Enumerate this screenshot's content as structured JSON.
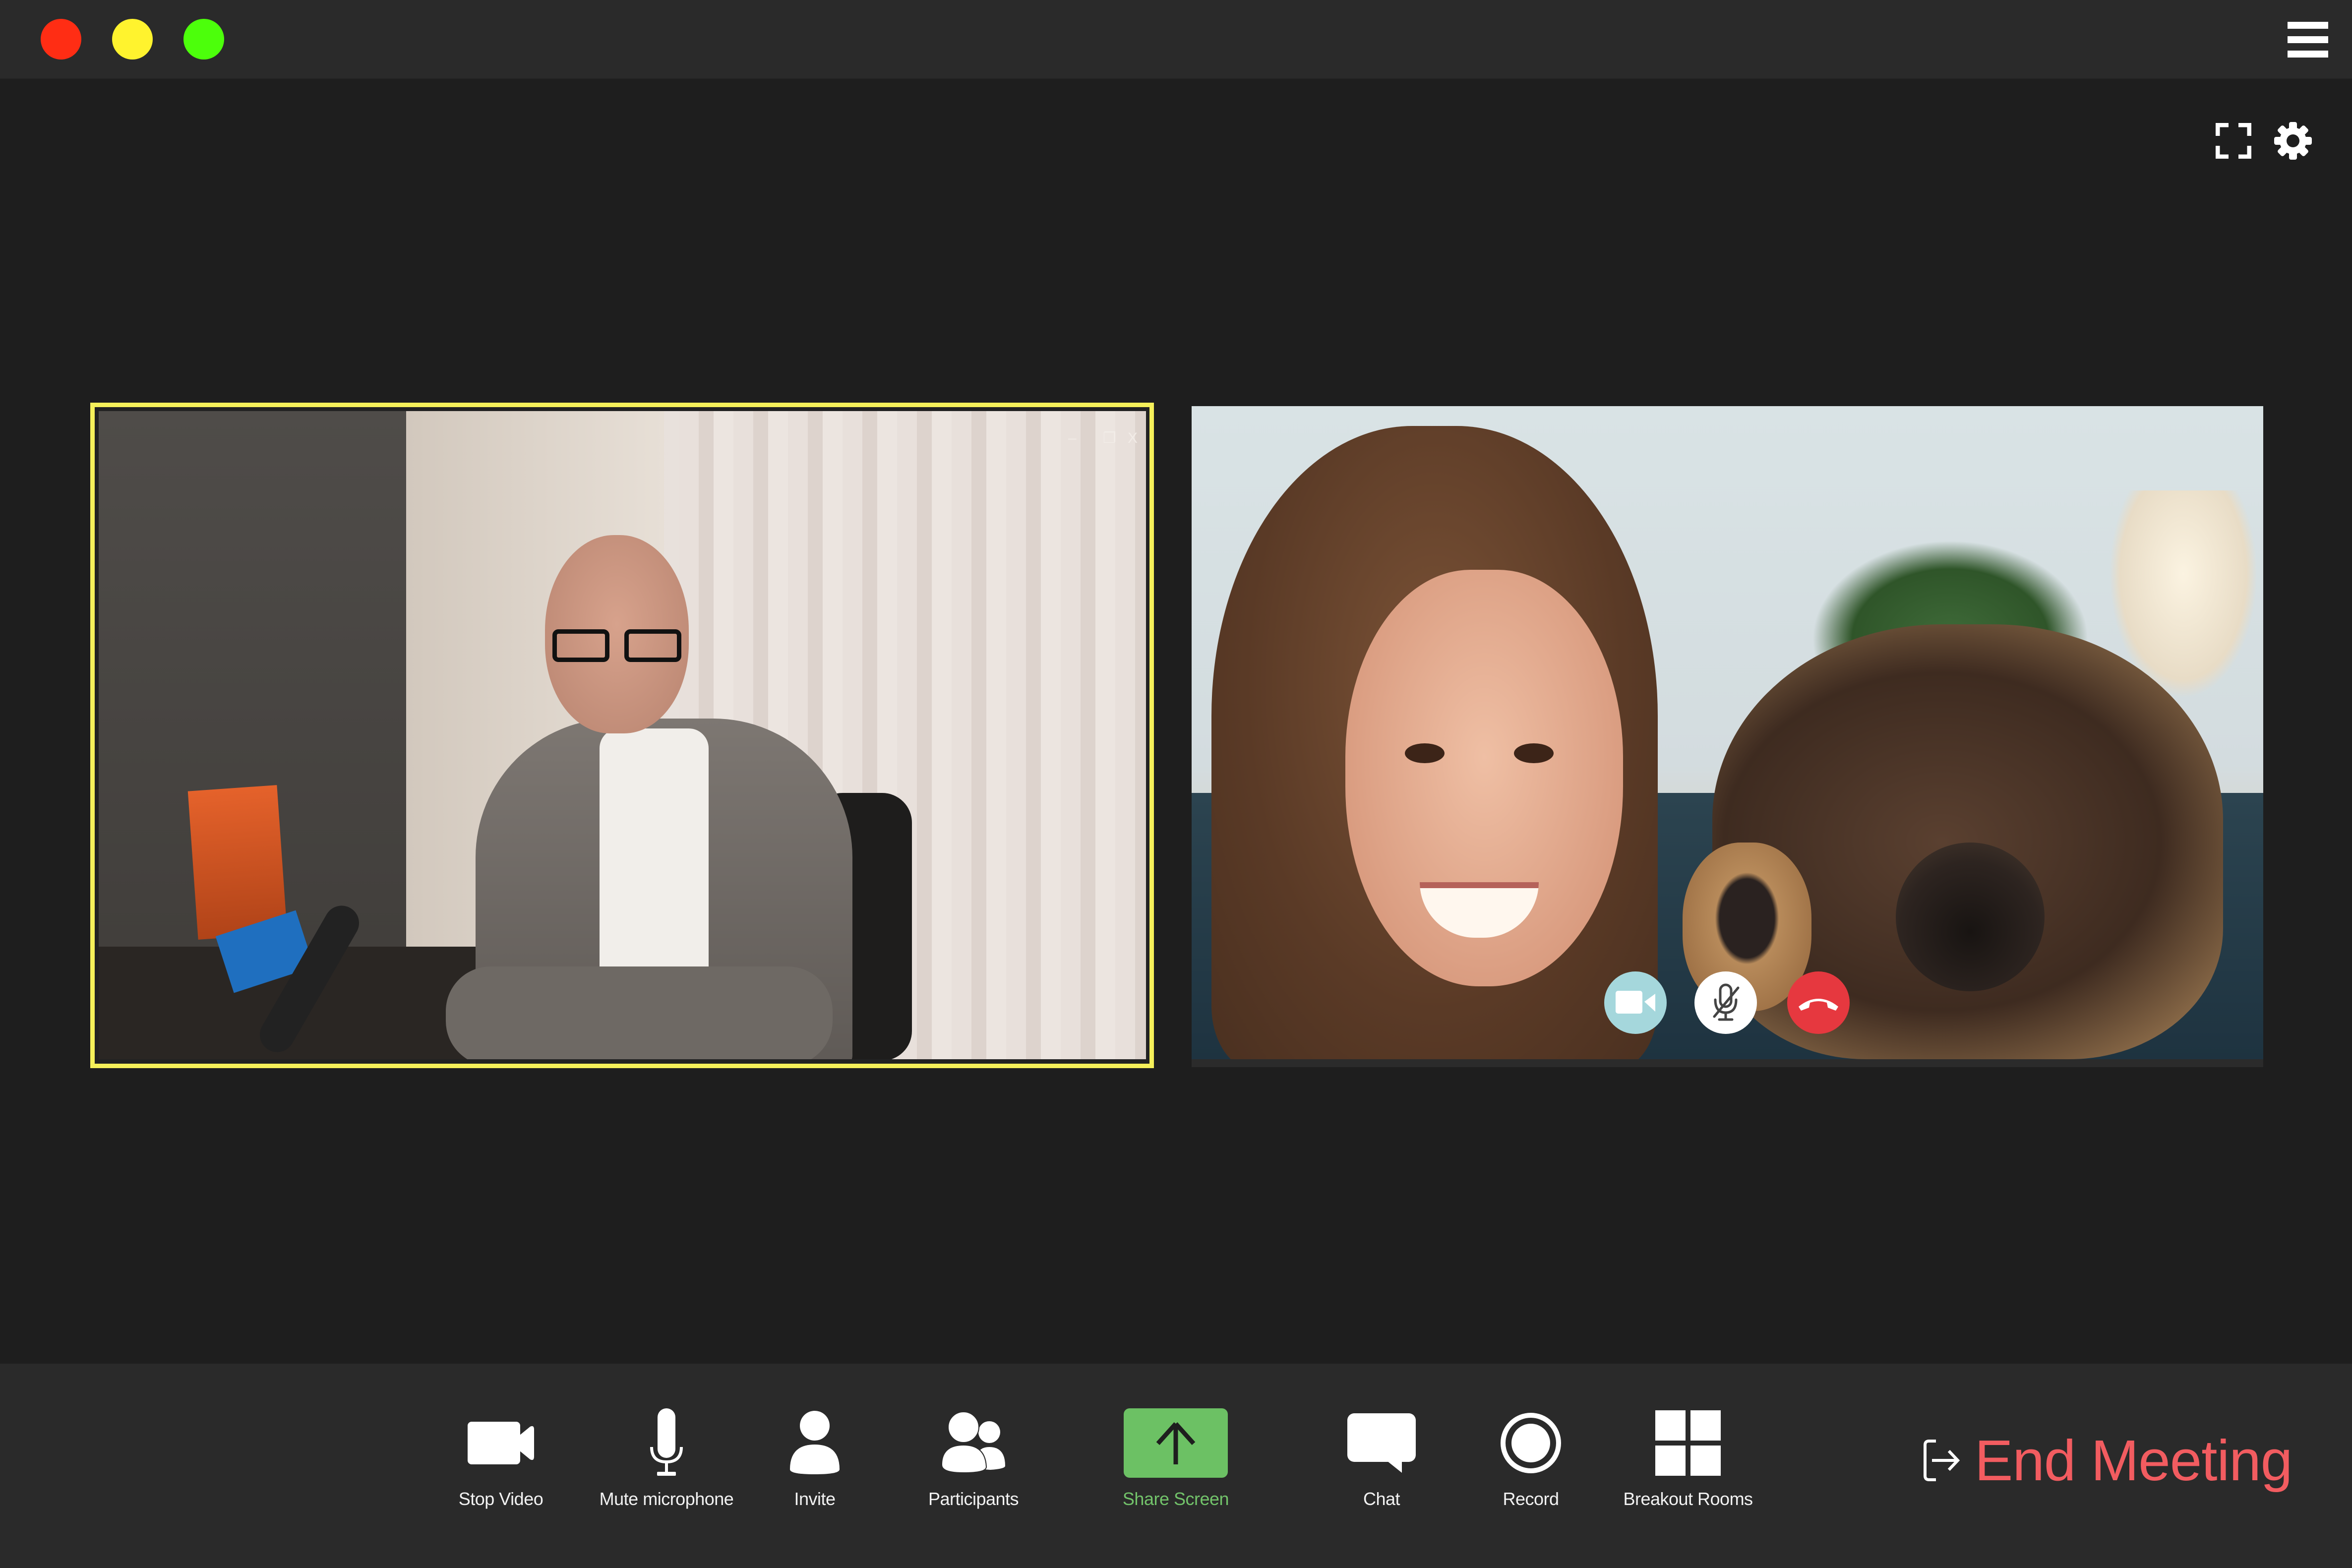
{
  "window": {
    "traffic_lights": [
      {
        "name": "close",
        "color": "#ff2d14"
      },
      {
        "name": "minimize",
        "color": "#fff32e"
      },
      {
        "name": "maximize",
        "color": "#4cff0b"
      }
    ],
    "menu_icon": "hamburger-icon"
  },
  "top_controls": {
    "fullscreen_icon": "fullscreen-icon",
    "settings_icon": "gear-icon"
  },
  "participants": [
    {
      "id": "speaker",
      "active_speaker": true,
      "highlight_color": "#f5f05a",
      "window_controls": {
        "minimize": "–",
        "restore": "❐",
        "close": "X"
      }
    },
    {
      "id": "guest",
      "active_speaker": false,
      "overlay_controls": [
        {
          "name": "video",
          "icon": "video-camera-icon",
          "color": "#a5d7dc"
        },
        {
          "name": "mute",
          "icon": "mic-off-icon",
          "color": "#ffffff"
        },
        {
          "name": "hang-up",
          "icon": "phone-hangup-icon",
          "color": "#e6383f"
        }
      ]
    }
  ],
  "toolbar": {
    "items": [
      {
        "id": "stop-video",
        "label": "Stop Video",
        "icon": "video-camera-icon"
      },
      {
        "id": "mute-microphone",
        "label": "Mute microphone",
        "icon": "microphone-icon"
      },
      {
        "id": "invite",
        "label": "Invite",
        "icon": "person-icon"
      },
      {
        "id": "participants",
        "label": "Participants",
        "icon": "people-icon"
      },
      {
        "id": "share-screen",
        "label": "Share Screen",
        "icon": "share-arrow-icon",
        "accent": "#6cc164"
      },
      {
        "id": "chat",
        "label": "Chat",
        "icon": "chat-bubble-icon"
      },
      {
        "id": "record",
        "label": "Record",
        "icon": "record-icon"
      },
      {
        "id": "breakout-rooms",
        "label": "Breakout Rooms",
        "icon": "grid-icon"
      }
    ],
    "end_meeting": {
      "label": "End Meeting",
      "icon": "exit-icon",
      "color": "#f25c60"
    }
  }
}
